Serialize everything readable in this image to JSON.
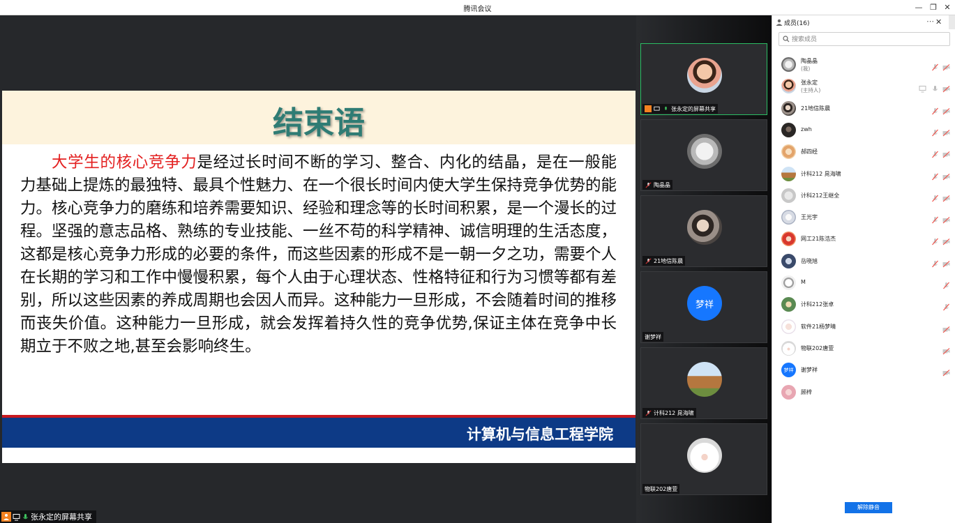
{
  "window": {
    "title": "腾讯会议"
  },
  "slide": {
    "title": "结束语",
    "highlight": "大学生的核心竞争力",
    "body": "是经过长时间不断的学习、整合、内化的结晶，是在一般能力基础上提炼的最独特、最具个性魅力、在一个很长时间内使大学生保持竞争优势的能力。核心竞争力的磨练和培养需要知识、经验和理念等的长时间积累，是一个漫长的过程。坚强的意志品格、熟练的专业技能、一丝不苟的科学精神、诚信明理的生活态度，这都是核心竞争力形成的必要的条件，而这些因素的形成不是一朝一夕之功，需要个人在长期的学习和工作中慢慢积累，每个人由于心理状态、性格特征和行为习惯等都有差别，所以这些因素的养成周期也会因人而异。这种能力一旦形成，不会随着时间的推移而丧失价值。这种能力一旦形成，就会发挥着持久性的竞争优势,保证主体在竞争中长期立于不败之地,甚至会影响终生。",
    "footer": "计算机与信息工程学院"
  },
  "share_label": "张永定的屏幕共享",
  "tiles": [
    {
      "name": "张永定的屏幕共享",
      "active": true,
      "avatar": "photo-child",
      "icons": [
        "host-icon",
        "share-icon",
        "mic-on-icon"
      ]
    },
    {
      "name": "陶晶晶",
      "active": false,
      "avatar": "photo-gray",
      "icons": [
        "mic-off-icon"
      ]
    },
    {
      "name": "21地信陈晨",
      "active": false,
      "avatar": "photo-people",
      "icons": [
        "mic-off-icon"
      ]
    },
    {
      "name": "谢梦祥",
      "active": false,
      "avatar": "letters",
      "avatar_text": "梦祥",
      "icons": []
    },
    {
      "name": "计科212 晁海啸",
      "active": false,
      "avatar": "photo-tower",
      "icons": [
        "mic-off-icon"
      ]
    },
    {
      "name": "物联202唐萱",
      "active": false,
      "avatar": "photo-dog",
      "icons": []
    }
  ],
  "panel": {
    "title": "成员(16)",
    "search_placeholder": "搜索成员",
    "members": [
      {
        "name": "陶晶晶",
        "role": "(我)",
        "avatar": "photo-gray",
        "mic": "muted",
        "cam": "off"
      },
      {
        "name": "张永定",
        "role": "(主持人)",
        "avatar": "photo-child",
        "share": true,
        "mic": "on",
        "cam": "off"
      },
      {
        "name": "21地信陈晨",
        "role": "",
        "avatar": "photo-people",
        "mic": "muted",
        "cam": "off"
      },
      {
        "name": "zwh",
        "role": "",
        "avatar": "photo-dark",
        "mic": "muted",
        "cam": "off"
      },
      {
        "name": "郝四经",
        "role": "",
        "avatar": "photo-warm",
        "mic": "muted",
        "cam": "off"
      },
      {
        "name": "计科212 晁海啸",
        "role": "",
        "avatar": "photo-tower",
        "mic": "muted",
        "cam": "off"
      },
      {
        "name": "计科212王继全",
        "role": "",
        "avatar": "photo-light",
        "mic": "muted",
        "cam": "off"
      },
      {
        "name": "王光宇",
        "role": "",
        "avatar": "photo-drawing",
        "mic": "muted",
        "cam": "off"
      },
      {
        "name": "网工21陈浩杰",
        "role": "",
        "avatar": "photo-red",
        "mic": "muted",
        "cam": "off"
      },
      {
        "name": "岳晓旭",
        "role": "",
        "avatar": "photo-blue",
        "mic": "muted",
        "cam": "off"
      },
      {
        "name": "M",
        "role": "",
        "avatar": "photo-sketch",
        "mic": "muted",
        "cam": "none"
      },
      {
        "name": "计科212张卓",
        "role": "",
        "avatar": "photo-green",
        "mic": "muted",
        "cam": "none"
      },
      {
        "name": "软件21杨梦晴",
        "role": "",
        "avatar": "photo-girl",
        "mic": "none",
        "cam": "off"
      },
      {
        "name": "物联202唐萱",
        "role": "",
        "avatar": "photo-dog",
        "mic": "none",
        "cam": "off"
      },
      {
        "name": "谢梦祥",
        "role": "",
        "avatar": "letters",
        "avatar_text": "梦祥",
        "mic": "none",
        "cam": "off"
      },
      {
        "name": "顾梓",
        "role": "",
        "avatar": "photo-pink",
        "mic": "none",
        "cam": "none"
      }
    ],
    "unmute_label": "解除静音"
  },
  "colors": {
    "accent_blue": "#1272e8",
    "slide_title": "#2f7c74",
    "highlight_red": "#e32020",
    "footer_blue": "#0d3a86",
    "active_border": "#2bbd63",
    "host_orange": "#f58220"
  }
}
